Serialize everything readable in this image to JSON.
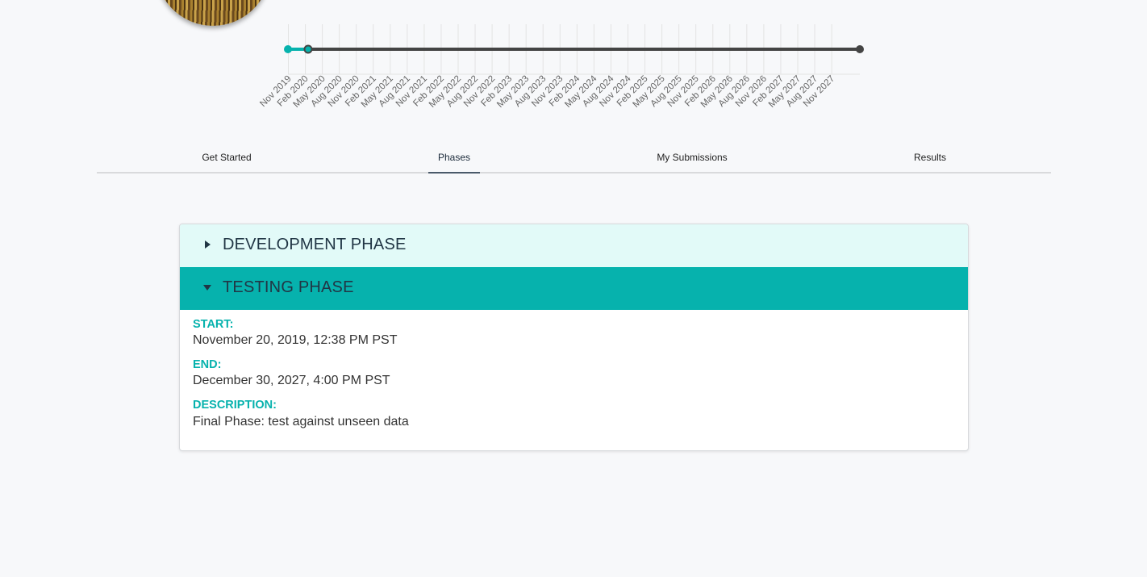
{
  "timeline": {
    "ticks": [
      "Nov 2019",
      "Feb 2020",
      "May 2020",
      "Aug 2020",
      "Nov 2020",
      "Feb 2021",
      "May 2021",
      "Aug 2021",
      "Nov 2021",
      "Feb 2022",
      "May 2022",
      "Aug 2022",
      "Nov 2022",
      "Feb 2023",
      "May 2023",
      "Aug 2023",
      "Nov 2023",
      "Feb 2024",
      "May 2024",
      "Aug 2024",
      "Nov 2024",
      "Feb 2025",
      "May 2025",
      "Aug 2025",
      "Nov 2025",
      "Feb 2026",
      "May 2026",
      "Aug 2026",
      "Nov 2026",
      "Feb 2027",
      "May 2027",
      "Aug 2027",
      "Nov 2027"
    ],
    "colors": {
      "progress": "#06b2ad",
      "track": "#444444",
      "grid": "#e3e3e3",
      "tick_text": "#666666"
    }
  },
  "tabs": [
    {
      "label": "Get Started"
    },
    {
      "label": "Phases",
      "active": true
    },
    {
      "label": "My Submissions"
    },
    {
      "label": "Results"
    }
  ],
  "phases": {
    "development": {
      "title": "DEVELOPMENT PHASE",
      "expanded": false,
      "icon": "caret-right-icon"
    },
    "testing": {
      "title": "TESTING PHASE",
      "expanded": true,
      "icon": "caret-down-icon",
      "start_label": "START:",
      "start": "November 20, 2019, 12:38 PM PST",
      "end_label": "END:",
      "end": "December 30, 2027, 4:00 PM PST",
      "description_label": "DESCRIPTION:",
      "description": "Final Phase: test against unseen data"
    }
  },
  "colors": {
    "accent": "#06b2ad",
    "dev_header_bg": "#e2faf8",
    "title_text": "#213645"
  }
}
